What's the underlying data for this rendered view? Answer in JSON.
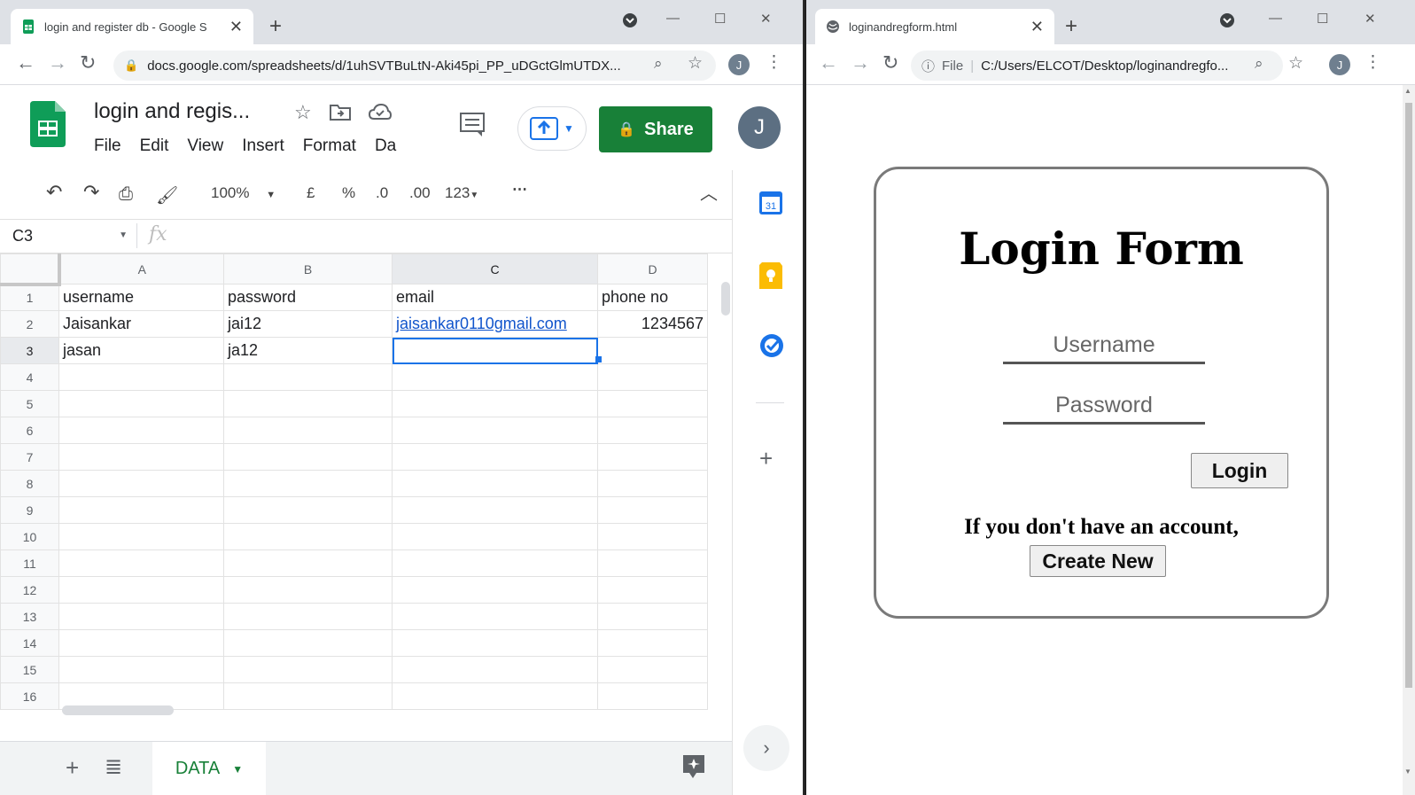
{
  "left_browser": {
    "tab_title": "login and register db - Google S",
    "url": "docs.google.com/spreadsheets/d/1uhSVTBuLtN-Aki45pi_PP_uDGctGlmUTDX...",
    "profile_initial": "J"
  },
  "sheets": {
    "title": "login and regis...",
    "menu": [
      "File",
      "Edit",
      "View",
      "Insert",
      "Format",
      "Da"
    ],
    "share_label": "Share",
    "account_initial": "J",
    "zoom": "100%",
    "currency": "£",
    "percent": "%",
    "dec_less": ".0",
    "dec_more": ".00",
    "format_num": "123",
    "cell_ref": "C3",
    "fx": "fx",
    "columns": [
      "A",
      "B",
      "C",
      "D"
    ],
    "rows": [
      [
        "username",
        "password",
        "email",
        "phone no"
      ],
      [
        "Jaisankar",
        "jai12",
        "jaisankar0110gmail.com",
        "1234567"
      ],
      [
        "jasan",
        "ja12",
        "",
        ""
      ]
    ],
    "row_numbers": [
      "1",
      "2",
      "3",
      "4",
      "5",
      "6",
      "7",
      "8",
      "9",
      "10",
      "11",
      "12",
      "13",
      "14",
      "15",
      "16"
    ],
    "sheet_tab": "DATA"
  },
  "right_browser": {
    "tab_title": "loginandregform.html",
    "url_prefix": "File",
    "url": "C:/Users/ELCOT/Desktop/loginandregfo...",
    "profile_initial": "J"
  },
  "login_page": {
    "title": "Login Form",
    "username_placeholder": "Username",
    "password_placeholder": "Password",
    "login_label": "Login",
    "note": "If you don't have an account,",
    "create_label": "Create New"
  }
}
